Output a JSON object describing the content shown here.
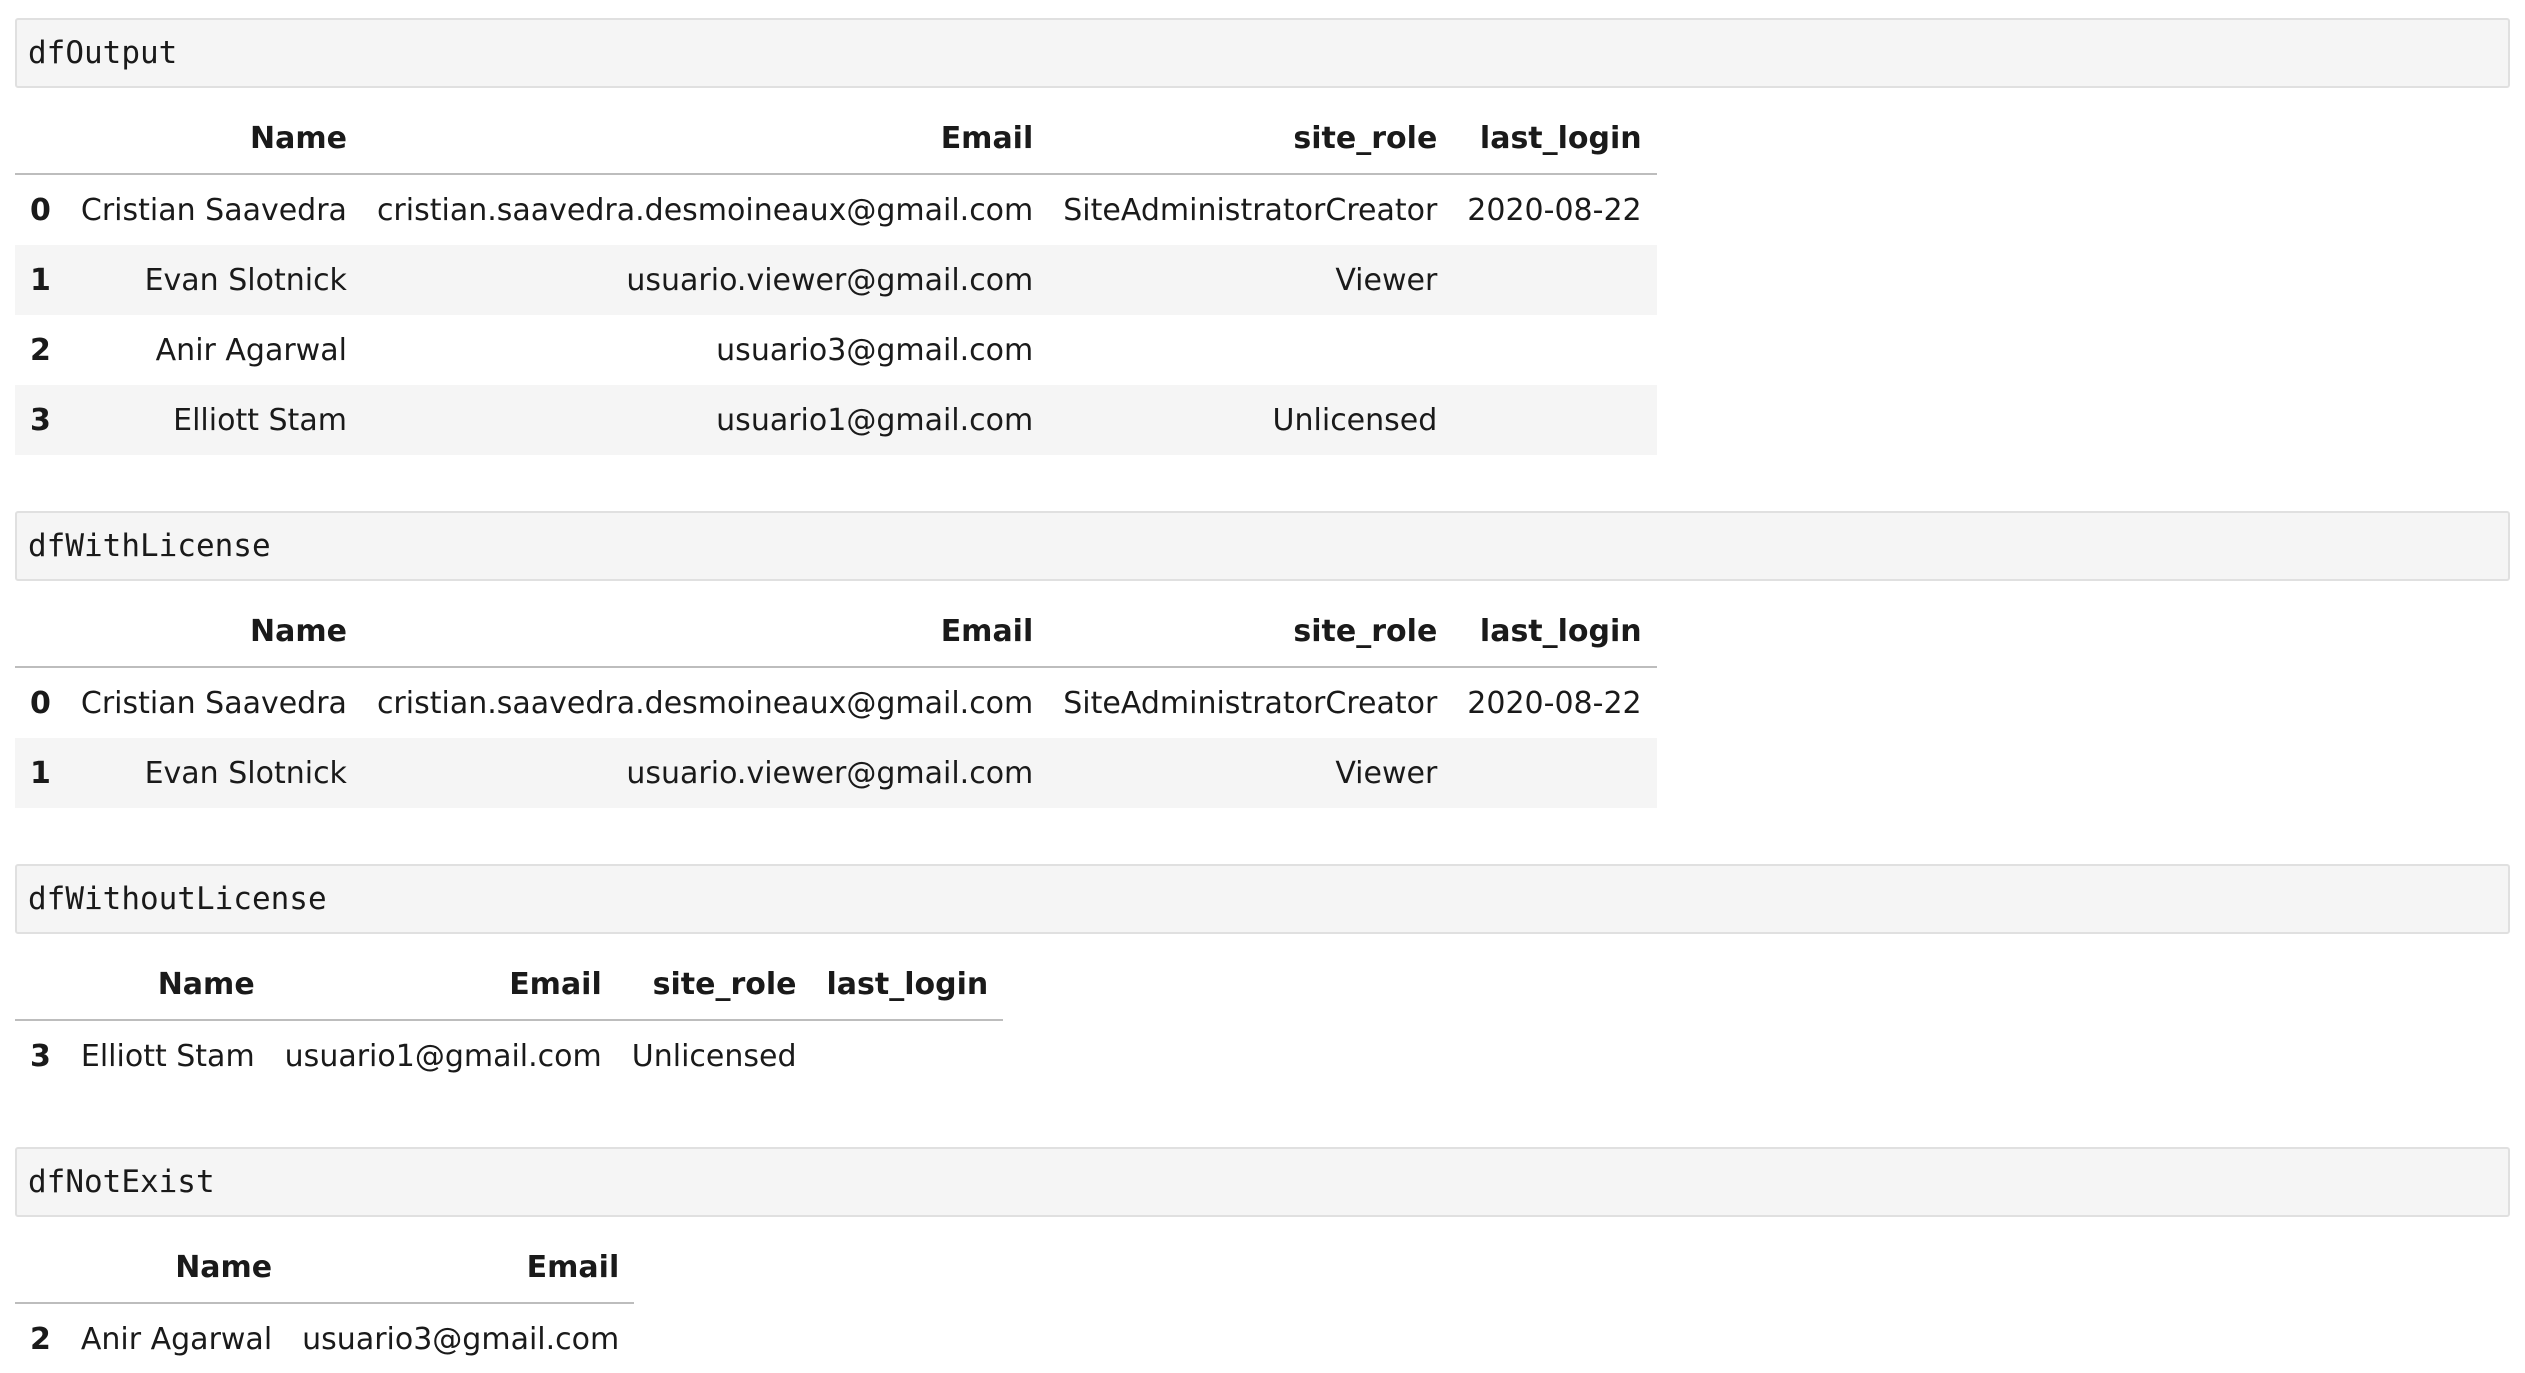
{
  "cells": [
    {
      "code": "dfOutput",
      "columns": [
        "Name",
        "Email",
        "site_role",
        "last_login"
      ],
      "rows": [
        {
          "index": "0",
          "values": [
            "Cristian Saavedra",
            "cristian.saavedra.desmoineaux@gmail.com",
            "SiteAdministratorCreator",
            "2020-08-22"
          ]
        },
        {
          "index": "1",
          "values": [
            "Evan Slotnick",
            "usuario.viewer@gmail.com",
            "Viewer",
            ""
          ]
        },
        {
          "index": "2",
          "values": [
            "Anir Agarwal",
            "usuario3@gmail.com",
            "",
            ""
          ]
        },
        {
          "index": "3",
          "values": [
            "Elliott Stam",
            "usuario1@gmail.com",
            "Unlicensed",
            ""
          ]
        }
      ]
    },
    {
      "code": "dfWithLicense",
      "columns": [
        "Name",
        "Email",
        "site_role",
        "last_login"
      ],
      "rows": [
        {
          "index": "0",
          "values": [
            "Cristian Saavedra",
            "cristian.saavedra.desmoineaux@gmail.com",
            "SiteAdministratorCreator",
            "2020-08-22"
          ]
        },
        {
          "index": "1",
          "values": [
            "Evan Slotnick",
            "usuario.viewer@gmail.com",
            "Viewer",
            ""
          ]
        }
      ]
    },
    {
      "code": "dfWithoutLicense",
      "columns": [
        "Name",
        "Email",
        "site_role",
        "last_login"
      ],
      "rows": [
        {
          "index": "3",
          "values": [
            "Elliott Stam",
            "usuario1@gmail.com",
            "Unlicensed",
            ""
          ]
        }
      ]
    },
    {
      "code": "dfNotExist",
      "columns": [
        "Name",
        "Email"
      ],
      "rows": [
        {
          "index": "2",
          "values": [
            "Anir Agarwal",
            "usuario3@gmail.com"
          ]
        }
      ]
    }
  ]
}
